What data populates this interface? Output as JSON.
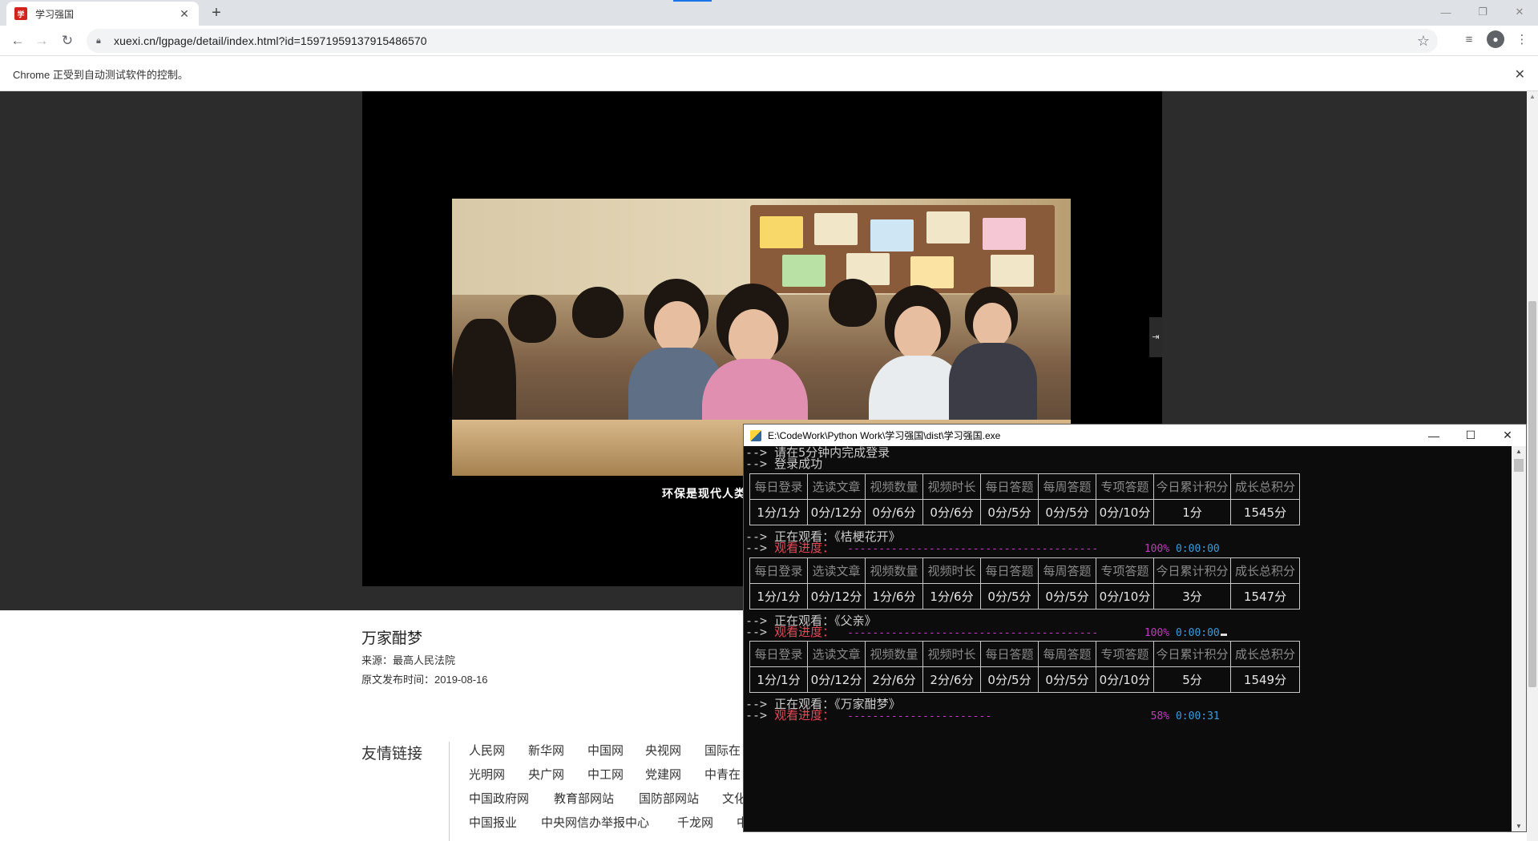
{
  "browser": {
    "tab_title": "学习强国",
    "tab_favicon": "学",
    "url": "xuexi.cn/lgpage/detail/index.html?id=15971959137915486570",
    "infobar_text": "Chrome 正受到自动测试软件的控制。"
  },
  "video": {
    "caption": "环保是现代人类"
  },
  "article": {
    "title": "万家酣梦",
    "source": "来源：最高人民法院",
    "published": "原文发布时间：2019-08-16"
  },
  "friend_links": {
    "title": "友情链接",
    "items": [
      "人民网",
      "新华网",
      "中国网",
      "央视网",
      "国际在",
      "光明网",
      "央广网",
      "中工网",
      "党建网",
      "中青在",
      "中国政府网",
      "教育部网站",
      "国防部网站",
      "文化",
      "中国报业",
      "中央网信办举报中心",
      "千龙网",
      "中"
    ]
  },
  "console": {
    "title": "E:\\CodeWork\\Python Work\\学习强国\\dist\\学习强国.exe",
    "prefix": "--> ",
    "login_prompt": "请在5分钟内完成登录",
    "login_ok": "登录成功",
    "headers": [
      "每日登录",
      "选读文章",
      "视频数量",
      "视频时长",
      "每日答题",
      "每周答题",
      "专项答题",
      "今日累计积分",
      "成长总积分"
    ],
    "tables": [
      [
        "1分/1分",
        "0分/12分",
        "0分/6分",
        "0分/6分",
        "0分/5分",
        "0分/5分",
        "0分/10分",
        "1分",
        "1545分"
      ],
      [
        "1分/1分",
        "0分/12分",
        "1分/6分",
        "1分/6分",
        "0分/5分",
        "0分/5分",
        "0分/10分",
        "3分",
        "1547分"
      ],
      [
        "1分/1分",
        "0分/12分",
        "2分/6分",
        "2分/6分",
        "0分/5分",
        "0分/5分",
        "0分/10分",
        "5分",
        "1549分"
      ]
    ],
    "watching": [
      {
        "label": "正在观看：《桔梗花开》",
        "progress_label": "观看进度：",
        "bar": "----------------------------------------",
        "percent": "100%",
        "time": "0:00:00",
        "fraction": 1.0
      },
      {
        "label": "正在观看：《父亲》",
        "progress_label": "观看进度：",
        "bar": "----------------------------------------",
        "percent": "100%",
        "time": "0:00:00",
        "fraction": 1.0
      },
      {
        "label": "正在观看：《万家酣梦》",
        "progress_label": "观看进度：",
        "bar": "-----------------------",
        "percent": "58%",
        "time": "0:00:31",
        "fraction": 0.58
      }
    ]
  }
}
